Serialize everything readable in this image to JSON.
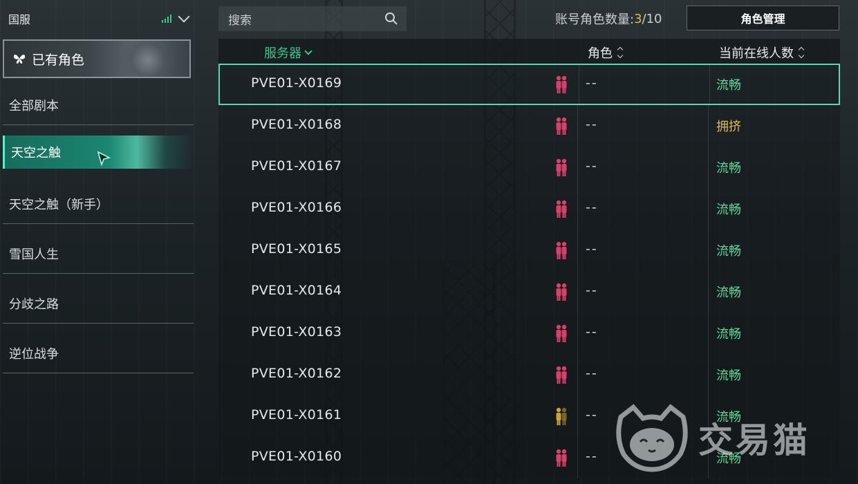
{
  "region": {
    "label": "国服"
  },
  "owned_tab": {
    "label": "已有角色"
  },
  "nav": [
    {
      "label": "全部剧本",
      "active": false
    },
    {
      "label": "天空之触",
      "active": true
    },
    {
      "label": "天空之触（新手）",
      "active": false
    },
    {
      "label": "雪国人生",
      "active": false
    },
    {
      "label": "分歧之路",
      "active": false
    },
    {
      "label": "逆位战争",
      "active": false
    }
  ],
  "search": {
    "placeholder": "搜索"
  },
  "account": {
    "label": "账号角色数量: ",
    "current": "3",
    "max": "/10"
  },
  "manage_button": {
    "label": "角色管理"
  },
  "table": {
    "headers": {
      "server": "服务器",
      "role": "角色",
      "online": "当前在线人数"
    },
    "rows": [
      {
        "server": "PVE01-X0169",
        "role": "--",
        "status": "流畅",
        "icon": "pink",
        "selected": true
      },
      {
        "server": "PVE01-X0168",
        "role": "--",
        "status": "拥挤",
        "icon": "pink"
      },
      {
        "server": "PVE01-X0167",
        "role": "--",
        "status": "流畅",
        "icon": "pink"
      },
      {
        "server": "PVE01-X0166",
        "role": "--",
        "status": "流畅",
        "icon": "pink"
      },
      {
        "server": "PVE01-X0165",
        "role": "--",
        "status": "流畅",
        "icon": "pink"
      },
      {
        "server": "PVE01-X0164",
        "role": "--",
        "status": "流畅",
        "icon": "pink"
      },
      {
        "server": "PVE01-X0163",
        "role": "--",
        "status": "流畅",
        "icon": "pink"
      },
      {
        "server": "PVE01-X0162",
        "role": "--",
        "status": "流畅",
        "icon": "pink"
      },
      {
        "server": "PVE01-X0161",
        "role": "--",
        "status": "流畅",
        "icon": "yellow"
      },
      {
        "server": "PVE01-X0160",
        "role": "--",
        "status": "流畅",
        "icon": "pink"
      }
    ]
  },
  "colors": {
    "accent": "#3ec48d",
    "smooth": "#5fd69a",
    "crowded": "#e2b84a",
    "icon_pink": "#d8406a",
    "icon_yellow": "#c9a532",
    "selected_border": "#5bd7b4"
  },
  "watermark": {
    "text": "交易猫"
  }
}
